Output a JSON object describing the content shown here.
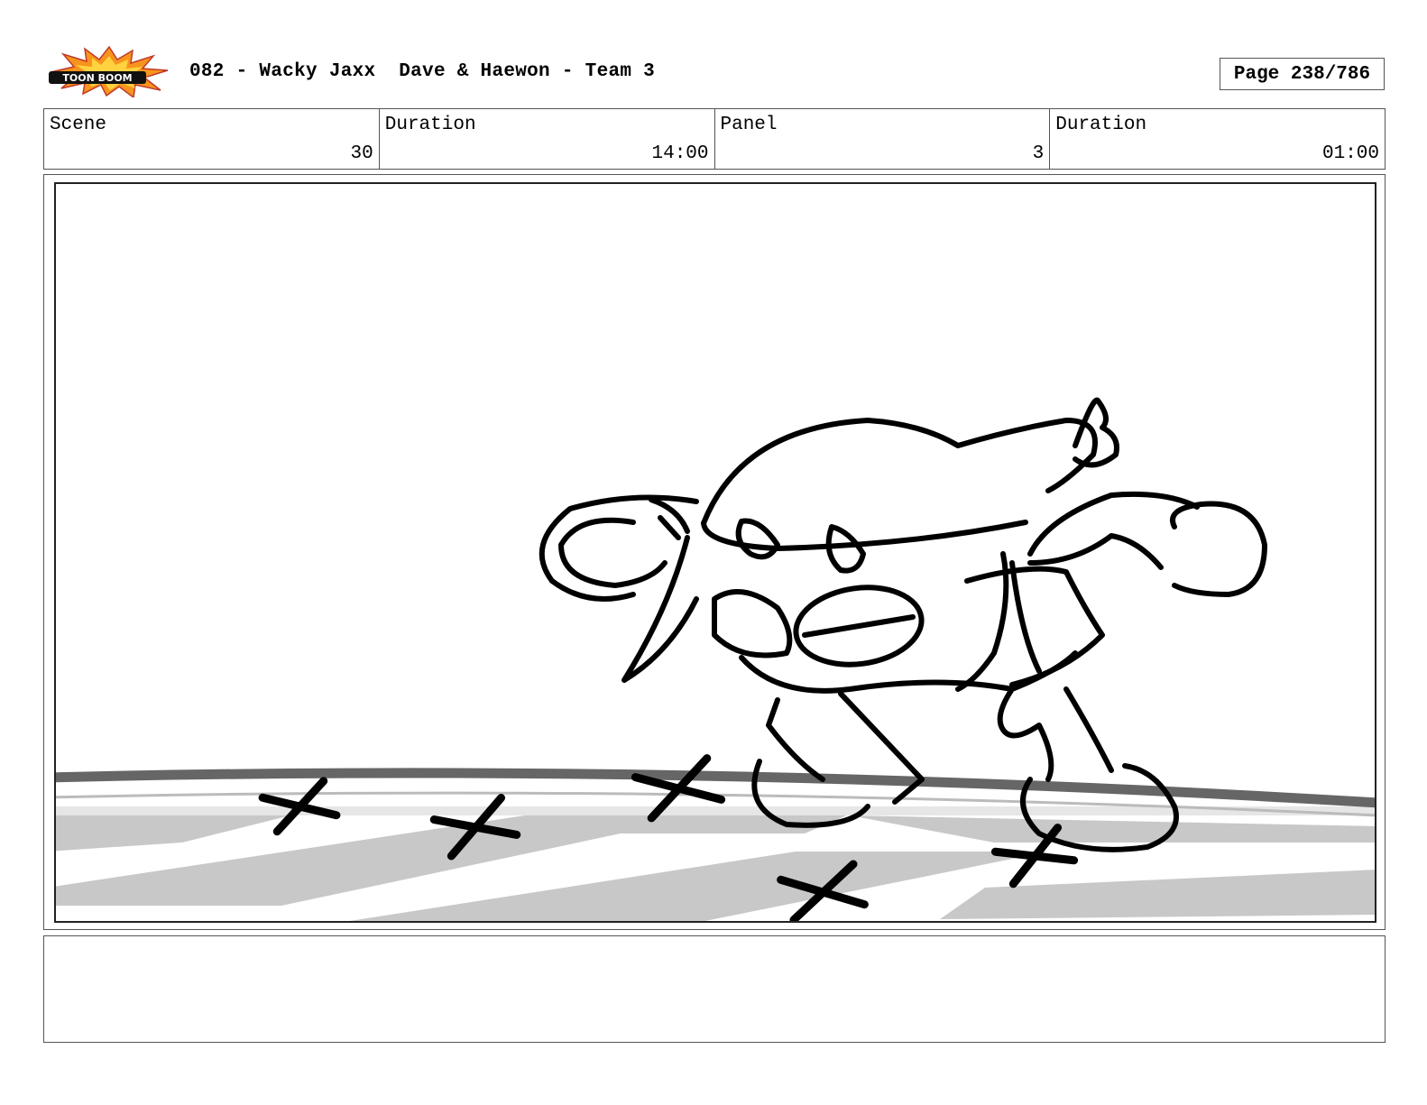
{
  "header": {
    "logo_text": "TOON BOOM",
    "title": "082 - Wacky Jaxx  Dave & Haewon - Team 3",
    "page_label": "Page 238/786"
  },
  "info": {
    "scene_label": "Scene",
    "scene_value": "30",
    "scene_duration_label": "Duration",
    "scene_duration_value": "14:00",
    "panel_label": "Panel",
    "panel_value": "3",
    "panel_duration_label": "Duration",
    "panel_duration_value": "01:00"
  },
  "notes": {
    "text": ""
  }
}
